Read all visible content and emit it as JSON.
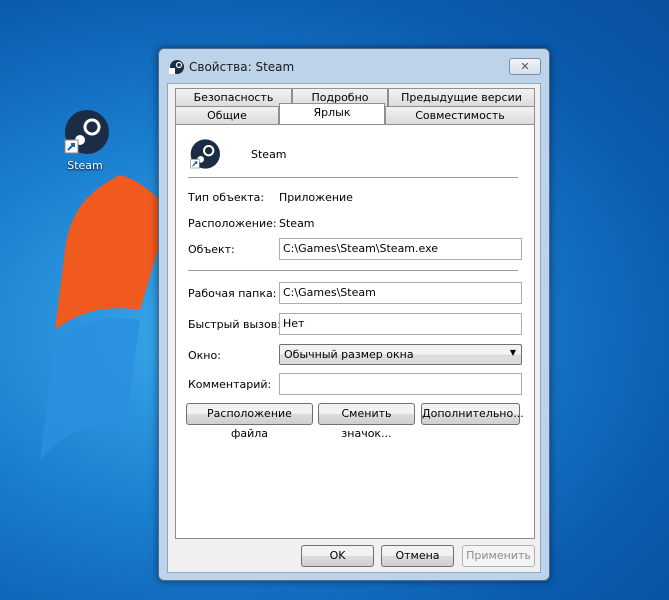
{
  "desktop": {
    "icon_label": "Steam"
  },
  "window": {
    "title": "Свойства: Steam",
    "close": "✕"
  },
  "tabs": {
    "row1": [
      "Безопасность",
      "Подробно",
      "Предыдущие версии"
    ],
    "row2": [
      "Общие",
      "Ярлык",
      "Совместимость"
    ],
    "active": "Ярлык"
  },
  "shortcut": {
    "name": "Steam",
    "type_label": "Тип объекта:",
    "type_value": "Приложение",
    "location_label": "Расположение:",
    "location_value": "Steam",
    "target_label": "Объект:",
    "target_value": "C:\\Games\\Steam\\Steam.exe",
    "startin_label": "Рабочая папка:",
    "startin_value": "C:\\Games\\Steam",
    "hotkey_label": "Быстрый вызов:",
    "hotkey_value": "Нет",
    "run_label": "Окно:",
    "run_value": "Обычный размер окна",
    "comment_label": "Комментарий:",
    "comment_value": "",
    "open_location": "Расположение файла",
    "change_icon": "Сменить значок...",
    "advanced": "Дополнительно..."
  },
  "footer": {
    "ok": "OK",
    "cancel": "Отмена",
    "apply": "Применить"
  }
}
